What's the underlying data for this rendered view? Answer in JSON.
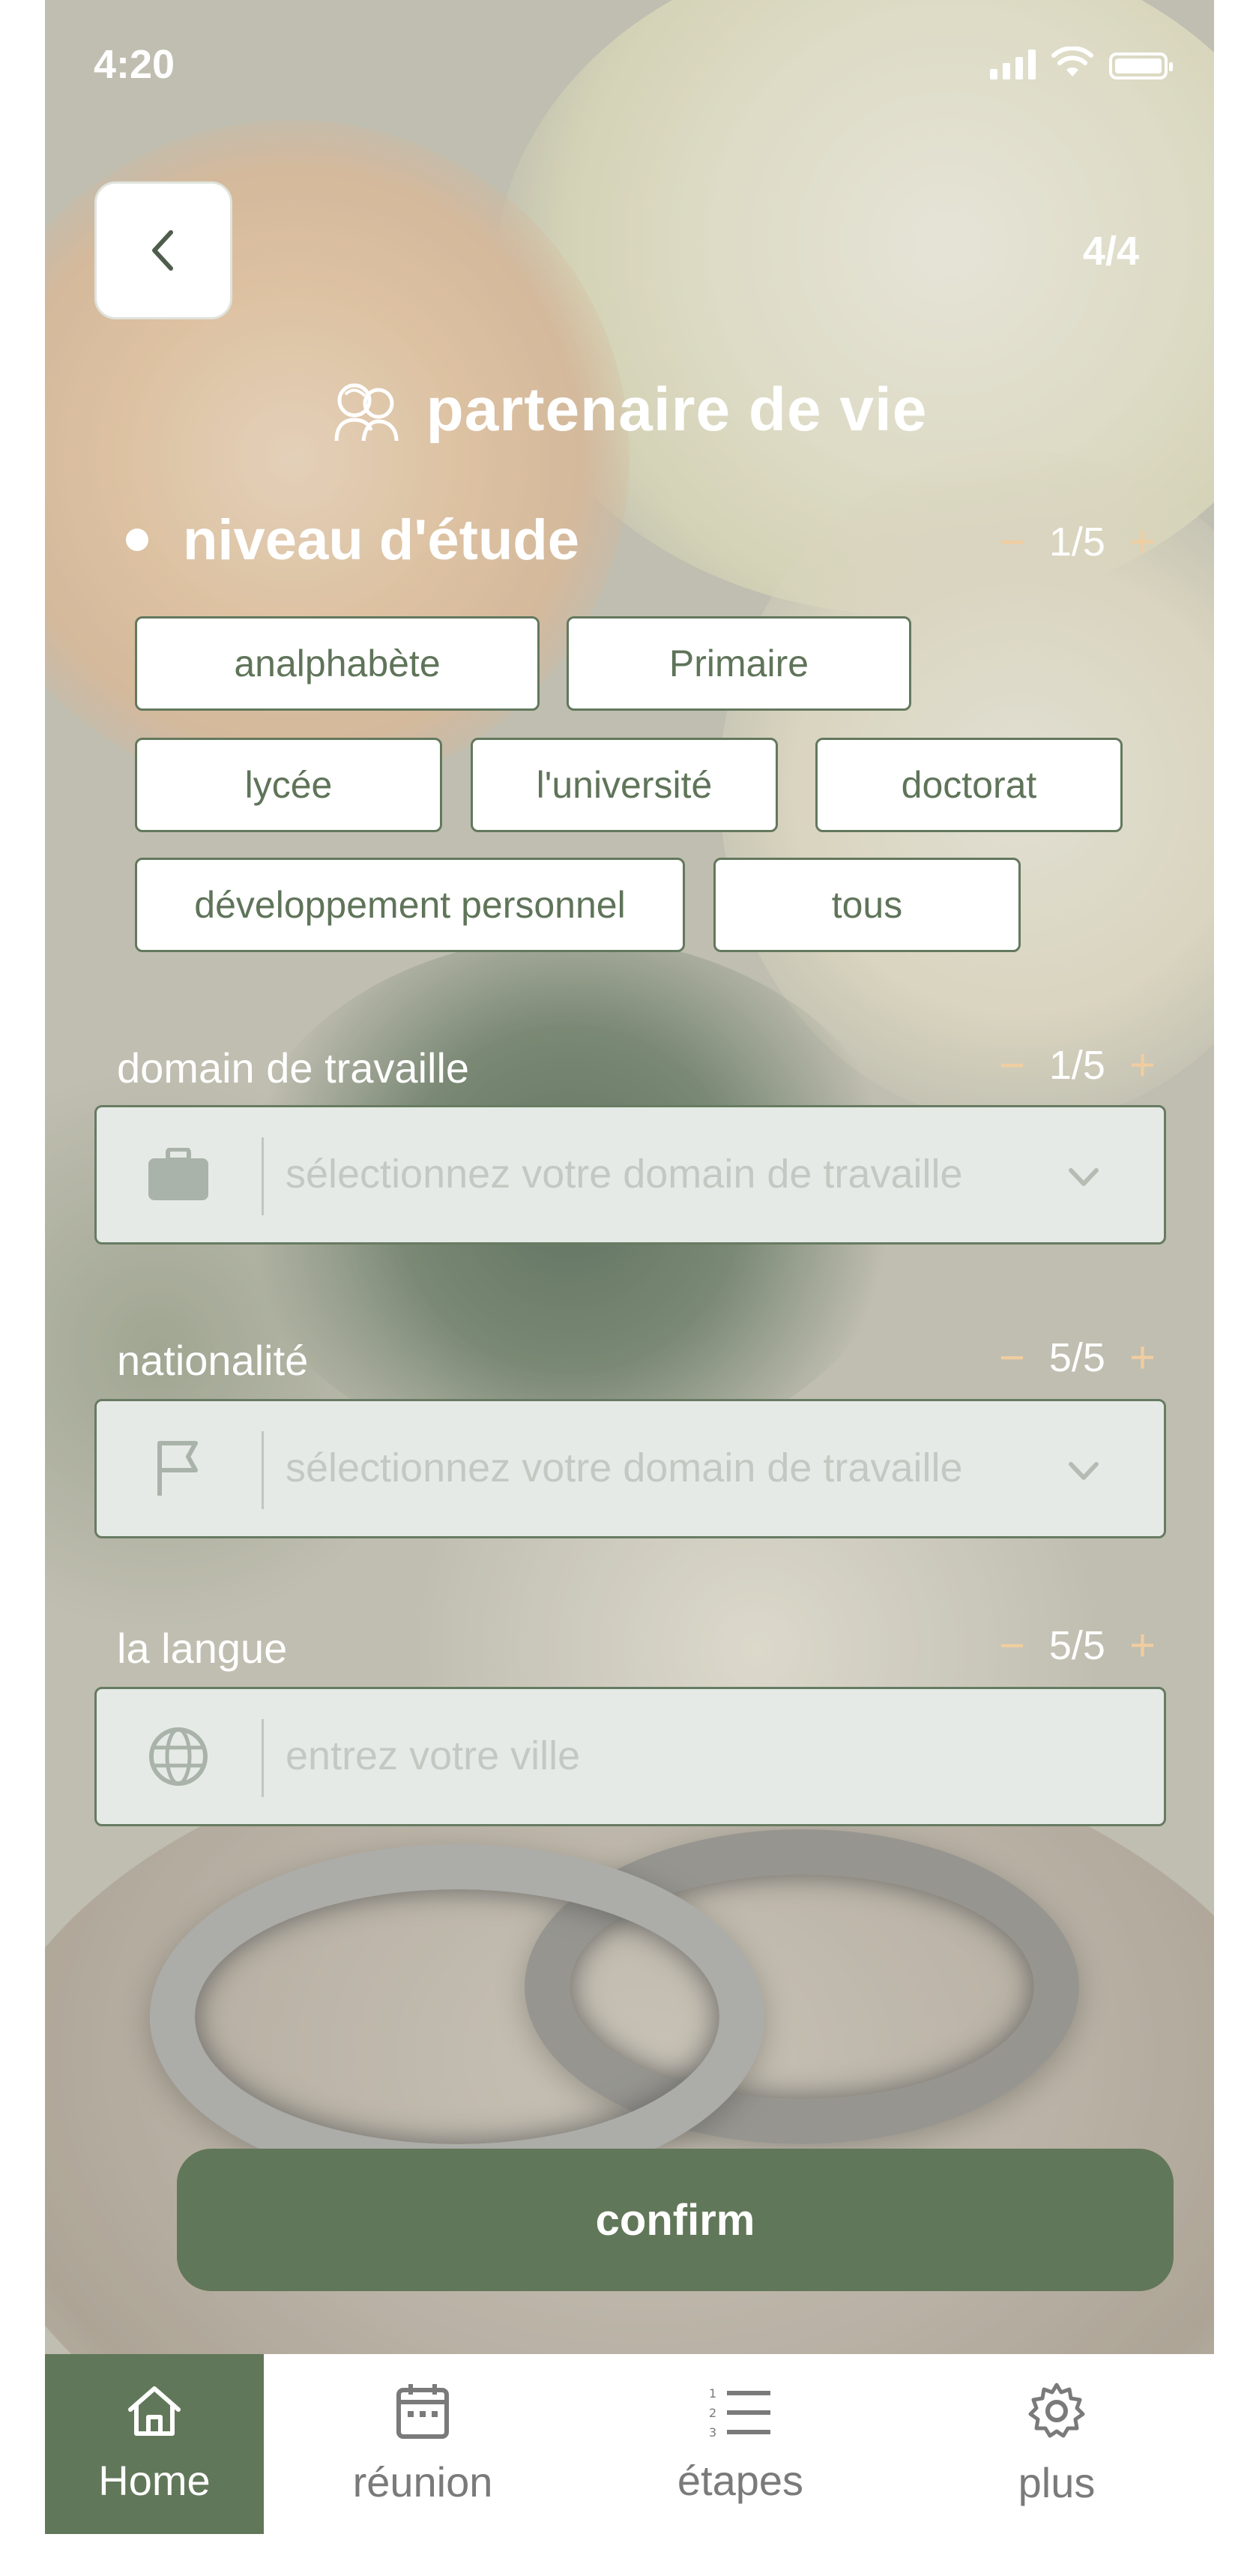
{
  "status_bar": {
    "time": "4:20"
  },
  "header": {
    "step": "4/4",
    "title": "partenaire de vie"
  },
  "education": {
    "label": "niveau d'étude",
    "counter": "1/5",
    "options": [
      "analphabète",
      "Primaire",
      "lycée",
      "l'université",
      "doctorat",
      "développement personnel",
      "tous"
    ]
  },
  "work_domain": {
    "label": "domain de travaille",
    "counter": "1/5",
    "placeholder": "sélectionnez votre domain de travaille"
  },
  "nationality": {
    "label": "nationalité",
    "counter": "5/5",
    "placeholder": "sélectionnez votre domain de travaille"
  },
  "language": {
    "label": "la langue",
    "counter": "5/5",
    "placeholder": "entrez votre ville"
  },
  "confirm_label": "confirm",
  "tabs": [
    {
      "label": "Home",
      "icon": "home-icon"
    },
    {
      "label": "réunion",
      "icon": "calendar-icon"
    },
    {
      "label": "étapes",
      "icon": "numbered-list-icon"
    },
    {
      "label": "plus",
      "icon": "gear-icon"
    }
  ],
  "colors": {
    "accent": "#617759",
    "counter_sign": "#f0cda0",
    "field_bg": "#e6eae6"
  }
}
